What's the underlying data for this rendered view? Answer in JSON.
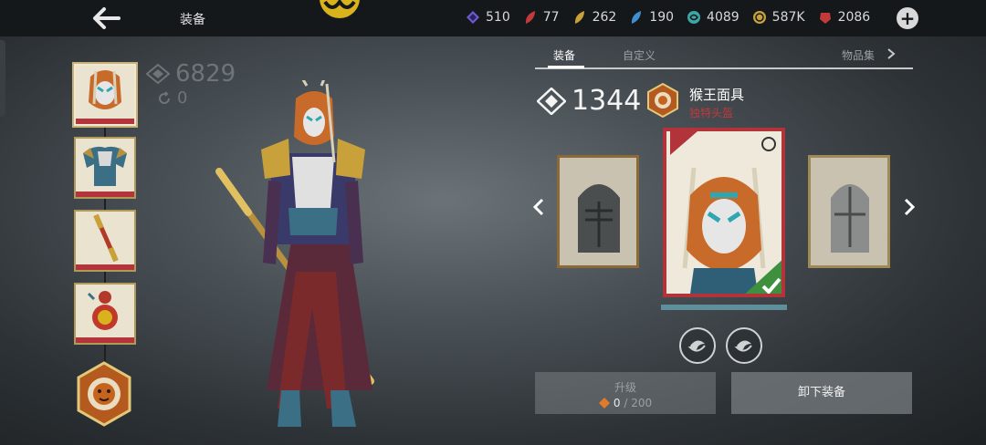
{
  "header": {
    "title": "装备",
    "currencies": [
      {
        "icon": "purple-gem-icon",
        "value": "510",
        "color": "#6d5bd0"
      },
      {
        "icon": "red-leaf-icon",
        "value": "77",
        "color": "#c23a3a"
      },
      {
        "icon": "gold-leaf-icon",
        "value": "262",
        "color": "#c9a13a"
      },
      {
        "icon": "blue-leaf-icon",
        "value": "190",
        "color": "#3f8fd0"
      },
      {
        "icon": "teal-swirl-icon",
        "value": "4089",
        "color": "#3fa6a6"
      },
      {
        "icon": "gold-coin-icon",
        "value": "587K",
        "color": "#c9a13a"
      },
      {
        "icon": "ruby-gem-icon",
        "value": "2086",
        "color": "#c23a3a"
      }
    ]
  },
  "character": {
    "gear_score": "6829",
    "reroll_count": "0"
  },
  "tabs": [
    {
      "label": "装备",
      "active": true
    },
    {
      "label": "自定义",
      "active": false
    },
    {
      "label": "物品集",
      "active": false
    }
  ],
  "item": {
    "score": "1344",
    "name": "猴王面具",
    "type": "独特头盔"
  },
  "upgrade": {
    "label": "升级",
    "current": "0",
    "separator": " / ",
    "max": "200"
  },
  "unequip_label": "卸下装备",
  "colors": {
    "accent_red": "#b2343a",
    "topbar": "#15181b",
    "gold": "#c9a13a"
  }
}
